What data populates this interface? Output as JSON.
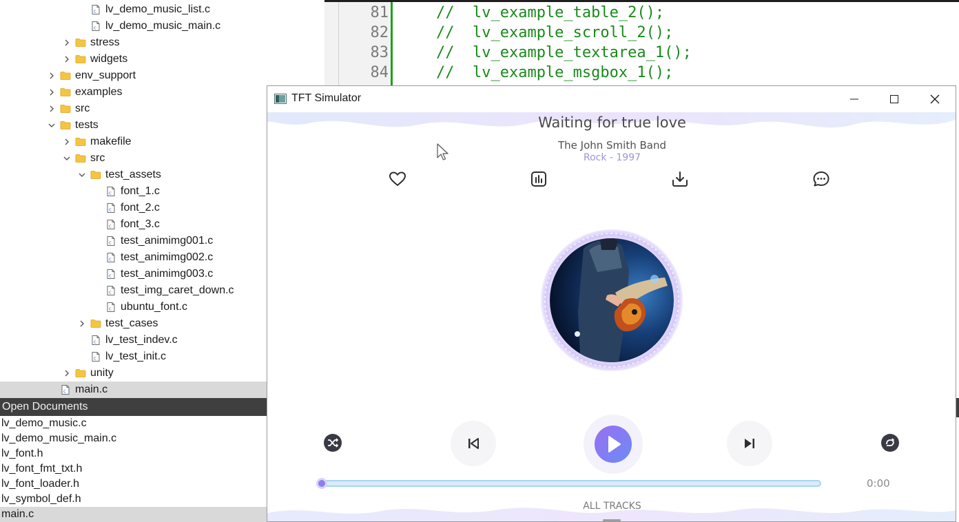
{
  "project_tree": {
    "rows": [
      {
        "label": "lv_demo_music_list.c",
        "kind": "file",
        "indent": 5,
        "chevron": "none"
      },
      {
        "label": "lv_demo_music_main.c",
        "kind": "file",
        "indent": 5,
        "chevron": "none"
      },
      {
        "label": "stress",
        "kind": "folder",
        "indent": 4,
        "chevron": "collapsed"
      },
      {
        "label": "widgets",
        "kind": "folder",
        "indent": 4,
        "chevron": "collapsed"
      },
      {
        "label": "env_support",
        "kind": "folder",
        "indent": 3,
        "chevron": "collapsed"
      },
      {
        "label": "examples",
        "kind": "folder",
        "indent": 3,
        "chevron": "collapsed"
      },
      {
        "label": "src",
        "kind": "folder",
        "indent": 3,
        "chevron": "collapsed"
      },
      {
        "label": "tests",
        "kind": "folder",
        "indent": 3,
        "chevron": "expanded"
      },
      {
        "label": "makefile",
        "kind": "folder",
        "indent": 4,
        "chevron": "collapsed"
      },
      {
        "label": "src",
        "kind": "folder",
        "indent": 4,
        "chevron": "expanded"
      },
      {
        "label": "test_assets",
        "kind": "folder",
        "indent": 5,
        "chevron": "expanded"
      },
      {
        "label": "font_1.c",
        "kind": "file",
        "indent": 6,
        "chevron": "none"
      },
      {
        "label": "font_2.c",
        "kind": "file",
        "indent": 6,
        "chevron": "none"
      },
      {
        "label": "font_3.c",
        "kind": "file",
        "indent": 6,
        "chevron": "none"
      },
      {
        "label": "test_animimg001.c",
        "kind": "file",
        "indent": 6,
        "chevron": "none"
      },
      {
        "label": "test_animimg002.c",
        "kind": "file",
        "indent": 6,
        "chevron": "none"
      },
      {
        "label": "test_animimg003.c",
        "kind": "file",
        "indent": 6,
        "chevron": "none"
      },
      {
        "label": "test_img_caret_down.c",
        "kind": "file",
        "indent": 6,
        "chevron": "none"
      },
      {
        "label": "ubuntu_font.c",
        "kind": "file",
        "indent": 6,
        "chevron": "none"
      },
      {
        "label": "test_cases",
        "kind": "folder",
        "indent": 5,
        "chevron": "collapsed"
      },
      {
        "label": "lv_test_indev.c",
        "kind": "file",
        "indent": 5,
        "chevron": "none"
      },
      {
        "label": "lv_test_init.c",
        "kind": "file",
        "indent": 5,
        "chevron": "none"
      },
      {
        "label": "unity",
        "kind": "folder",
        "indent": 4,
        "chevron": "collapsed"
      },
      {
        "label": "main.c",
        "kind": "file",
        "indent": 3,
        "chevron": "none",
        "selected": true
      }
    ]
  },
  "open_documents": {
    "header": "Open Documents",
    "items": [
      {
        "label": "lv_demo_music.c"
      },
      {
        "label": "lv_demo_music_main.c"
      },
      {
        "label": "lv_font.h"
      },
      {
        "label": "lv_font_fmt_txt.h"
      },
      {
        "label": "lv_font_loader.h"
      },
      {
        "label": "lv_symbol_def.h"
      },
      {
        "label": "main.c",
        "selected": true
      }
    ]
  },
  "editor": {
    "lines": [
      {
        "num": "81",
        "text": "//  lv_example_table_2();"
      },
      {
        "num": "82",
        "text": "//  lv_example_scroll_2();"
      },
      {
        "num": "83",
        "text": "//  lv_example_textarea_1();"
      },
      {
        "num": "84",
        "text": "//  lv_example_msgbox_1();"
      }
    ]
  },
  "simulator": {
    "window_title": "TFT Simulator",
    "song_title": "Waiting for true love",
    "artist": "The John Smith Band",
    "genre": "Rock - 1997",
    "elapsed_time": "0:00",
    "progress": 0.0,
    "all_tracks_label": "ALL TRACKS",
    "action_icons": [
      "heart-icon",
      "chart-icon",
      "download-icon",
      "chat-icon"
    ],
    "controls": [
      "shuffle-icon",
      "previous-icon",
      "play-icon",
      "next-icon",
      "loop-icon"
    ],
    "colors": {
      "accent": "#8d7ef0",
      "genre": "#9a96d2",
      "progress_track": "#a9d3f5"
    }
  }
}
